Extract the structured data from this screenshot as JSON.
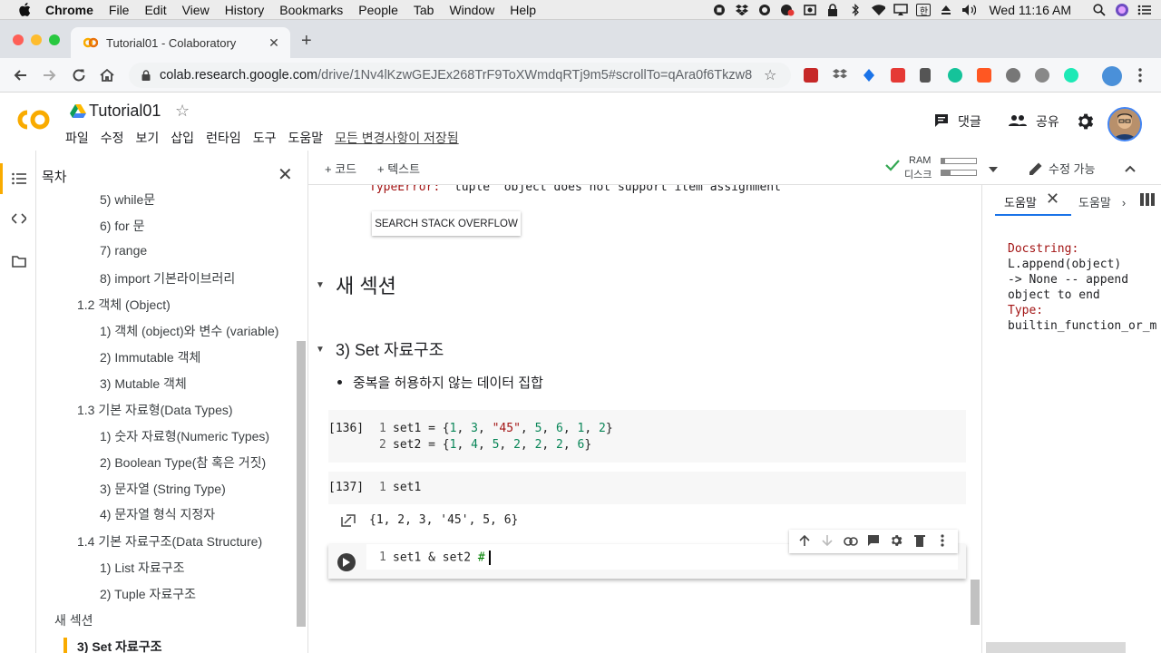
{
  "mac_menu": {
    "app": "Chrome",
    "items": [
      "File",
      "Edit",
      "View",
      "History",
      "Bookmarks",
      "People",
      "Tab",
      "Window",
      "Help"
    ],
    "clock": "Wed 11:16 AM",
    "ime": "한"
  },
  "browser": {
    "tab_title": "Tutorial01 - Colaboratory",
    "url_host": "colab.research.google.com",
    "url_path": "/drive/1Nv4lKzwGEJEx268TrF9ToXWmdqRTj9m5#scrollTo=qAra0f6Tkzw8"
  },
  "colab": {
    "title": "Tutorial01",
    "menus": [
      "파일",
      "수정",
      "보기",
      "삽입",
      "런타임",
      "도구",
      "도움말"
    ],
    "saved_status": "모든 변경사항이 저장됨",
    "comment_label": "댓글",
    "share_label": "공유"
  },
  "toc": {
    "heading": "목차",
    "items": [
      {
        "label": "5) while문"
      },
      {
        "label": "6) for 문"
      },
      {
        "label": "7) range"
      },
      {
        "label": "8) import 기본라이브러리"
      },
      {
        "label": "1.2 객체 (Object)"
      },
      {
        "label": "1) 객체 (object)와 변수 (variable)"
      },
      {
        "label": "2) Immutable 객체"
      },
      {
        "label": "3) Mutable 객체"
      },
      {
        "label": "1.3 기본 자료형(Data Types)"
      },
      {
        "label": "1) 숫자 자료형(Numeric Types)"
      },
      {
        "label": "2) Boolean Type(참 혹은 거짓)"
      },
      {
        "label": "3) 문자열 (String Type)"
      },
      {
        "label": "4) 문자열 형식 지정자"
      },
      {
        "label": "1.4 기본 자료구조(Data Structure)"
      },
      {
        "label": "1) List 자료구조"
      },
      {
        "label": "2) Tuple 자료구조"
      },
      {
        "label": "새 섹션"
      },
      {
        "label": "3) Set 자료구조"
      }
    ]
  },
  "toolbar": {
    "add_code": "+ 코드",
    "add_text": "+ 텍스트",
    "ram_label": "RAM",
    "disk_label": "디스크",
    "edit_mode": "수정 가능"
  },
  "notebook": {
    "error_type": "TypeError:",
    "error_msg": " 'tuple' object does not support item assignment",
    "so_button": "SEARCH STACK OVERFLOW",
    "section1": "새 섹션",
    "section2": "3) Set 자료구조",
    "bullet": "중복을 허용하지 않는 데이터 집합",
    "cell1": {
      "exec": "[136]",
      "ln1": "1",
      "ln2": "2",
      "line1": {
        "p1": "set1 = {",
        "n1": "1",
        "c1": ", ",
        "n2": "3",
        "c2": ", ",
        "s1": "\"45\"",
        "c3": ", ",
        "n3": "5",
        "c4": ", ",
        "n4": "6",
        "c5": ", ",
        "n5": "1",
        "c6": ", ",
        "n6": "2",
        "p2": "}"
      },
      "line2": {
        "p1": "set2 = {",
        "n1": "1",
        "c1": ", ",
        "n2": "4",
        "c2": ", ",
        "n3": "5",
        "c3": ", ",
        "n4": "2",
        "c4": ", ",
        "n5": "2",
        "c5": ", ",
        "n6": "2",
        "c6": ", ",
        "n7": "6",
        "p2": "}"
      }
    },
    "cell2": {
      "exec": "[137]",
      "ln1": "1",
      "code": "set1"
    },
    "output2": "{1, 2, 3, '45', 5, 6}",
    "cell3": {
      "ln1": "1",
      "code": "set1 & set2 ",
      "comment": "#"
    }
  },
  "help": {
    "tab1": "도움말",
    "tab2": "도움말",
    "docstring_label": "Docstring:",
    "doc_l1": "L.append(object)",
    "doc_l2": "-> None -- append",
    "doc_l3": "object to end",
    "type_label": "Type:",
    "type_value": "builtin_function_or_m"
  }
}
